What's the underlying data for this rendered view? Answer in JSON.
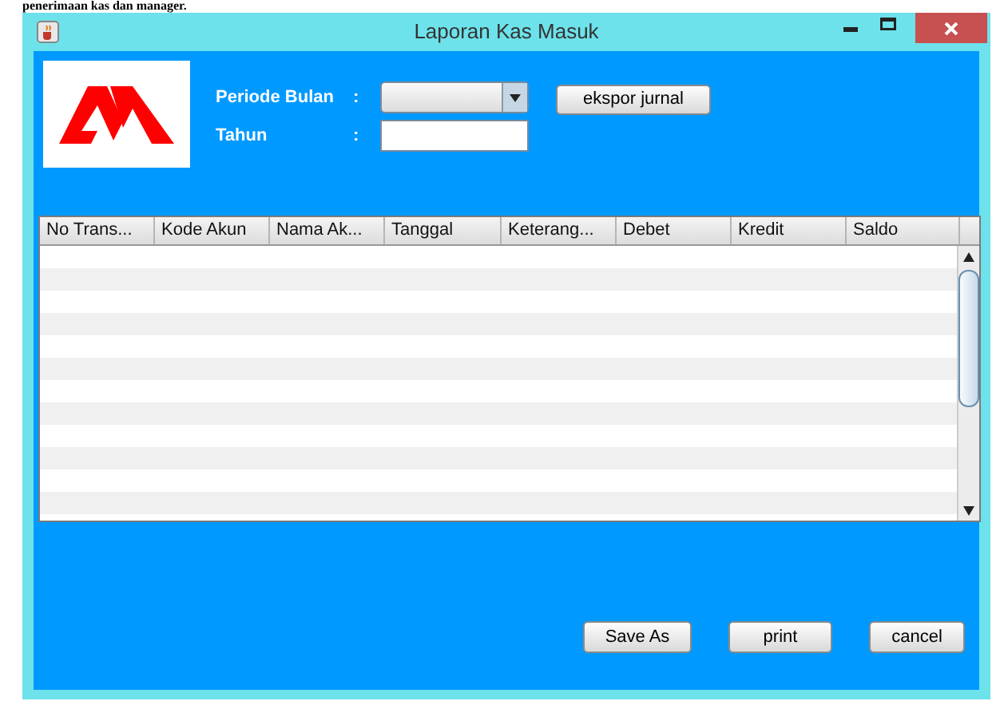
{
  "document_text": "penerimaan kas dan manager.",
  "window": {
    "title": "Laporan Kas Masuk"
  },
  "form": {
    "fields": [
      {
        "label": "Periode Bulan",
        "separator": ":",
        "kind": "dropdown"
      },
      {
        "label": "Tahun",
        "separator": ":",
        "kind": "text"
      }
    ],
    "export_button": "ekspor jurnal"
  },
  "table": {
    "columns": [
      "No Trans...",
      "Kode Akun",
      "Nama Ak...",
      "Tanggal",
      "Keterang...",
      "Debet",
      "Kredit",
      "Saldo"
    ]
  },
  "buttons": [
    "Save As",
    "print",
    "cancel"
  ]
}
